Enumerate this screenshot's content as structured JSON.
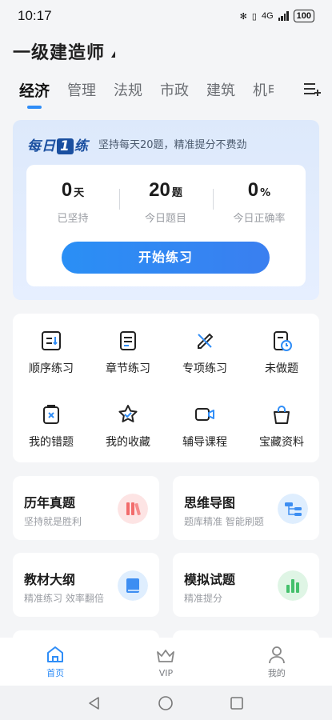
{
  "status": {
    "time": "10:17",
    "network": "4G",
    "battery": "100"
  },
  "header": {
    "title": "一级建造师"
  },
  "tabs": [
    "经济",
    "管理",
    "法规",
    "市政",
    "建筑",
    "机电"
  ],
  "daily": {
    "logo_a": "每日",
    "logo_num": "1",
    "logo_b": "练",
    "slogan": "坚持每天20题，精准提分不费劲",
    "stats": [
      {
        "value": "0",
        "unit": "天",
        "label": "已坚持"
      },
      {
        "value": "20",
        "unit": "题",
        "label": "今日题目"
      },
      {
        "value": "0",
        "unit": "%",
        "label": "今日正确率"
      }
    ],
    "start_label": "开始练习"
  },
  "grid": [
    {
      "label": "顺序练习",
      "icon": "list-order-icon"
    },
    {
      "label": "章节练习",
      "icon": "chapter-doc-icon"
    },
    {
      "label": "专项练习",
      "icon": "pencil-ruler-icon"
    },
    {
      "label": "未做题",
      "icon": "doc-clock-icon"
    },
    {
      "label": "我的错题",
      "icon": "wrong-doc-icon"
    },
    {
      "label": "我的收藏",
      "icon": "star-check-icon"
    },
    {
      "label": "辅导课程",
      "icon": "video-camera-icon"
    },
    {
      "label": "宝藏资料",
      "icon": "bag-icon"
    }
  ],
  "promos": [
    {
      "title": "历年真题",
      "subtitle": "坚持就是胜利",
      "icon": "books-icon",
      "color": "#f26b6b"
    },
    {
      "title": "思维导图",
      "subtitle": "题库精准 智能刷题",
      "icon": "mindmap-icon",
      "color": "#3d8ef2"
    },
    {
      "title": "教材大纲",
      "subtitle": "精准练习 效率翻倍",
      "icon": "textbook-icon",
      "color": "#3d8ef2"
    },
    {
      "title": "模拟试题",
      "subtitle": "精准提分",
      "icon": "bar-chart-icon",
      "color": "#44c06c"
    }
  ],
  "nav": [
    {
      "label": "首页",
      "icon": "home-icon"
    },
    {
      "label": "VIP",
      "icon": "crown-icon"
    },
    {
      "label": "我的",
      "icon": "user-icon"
    }
  ],
  "colors": {
    "accent": "#2f8df7",
    "background": "#f4f5f7"
  }
}
